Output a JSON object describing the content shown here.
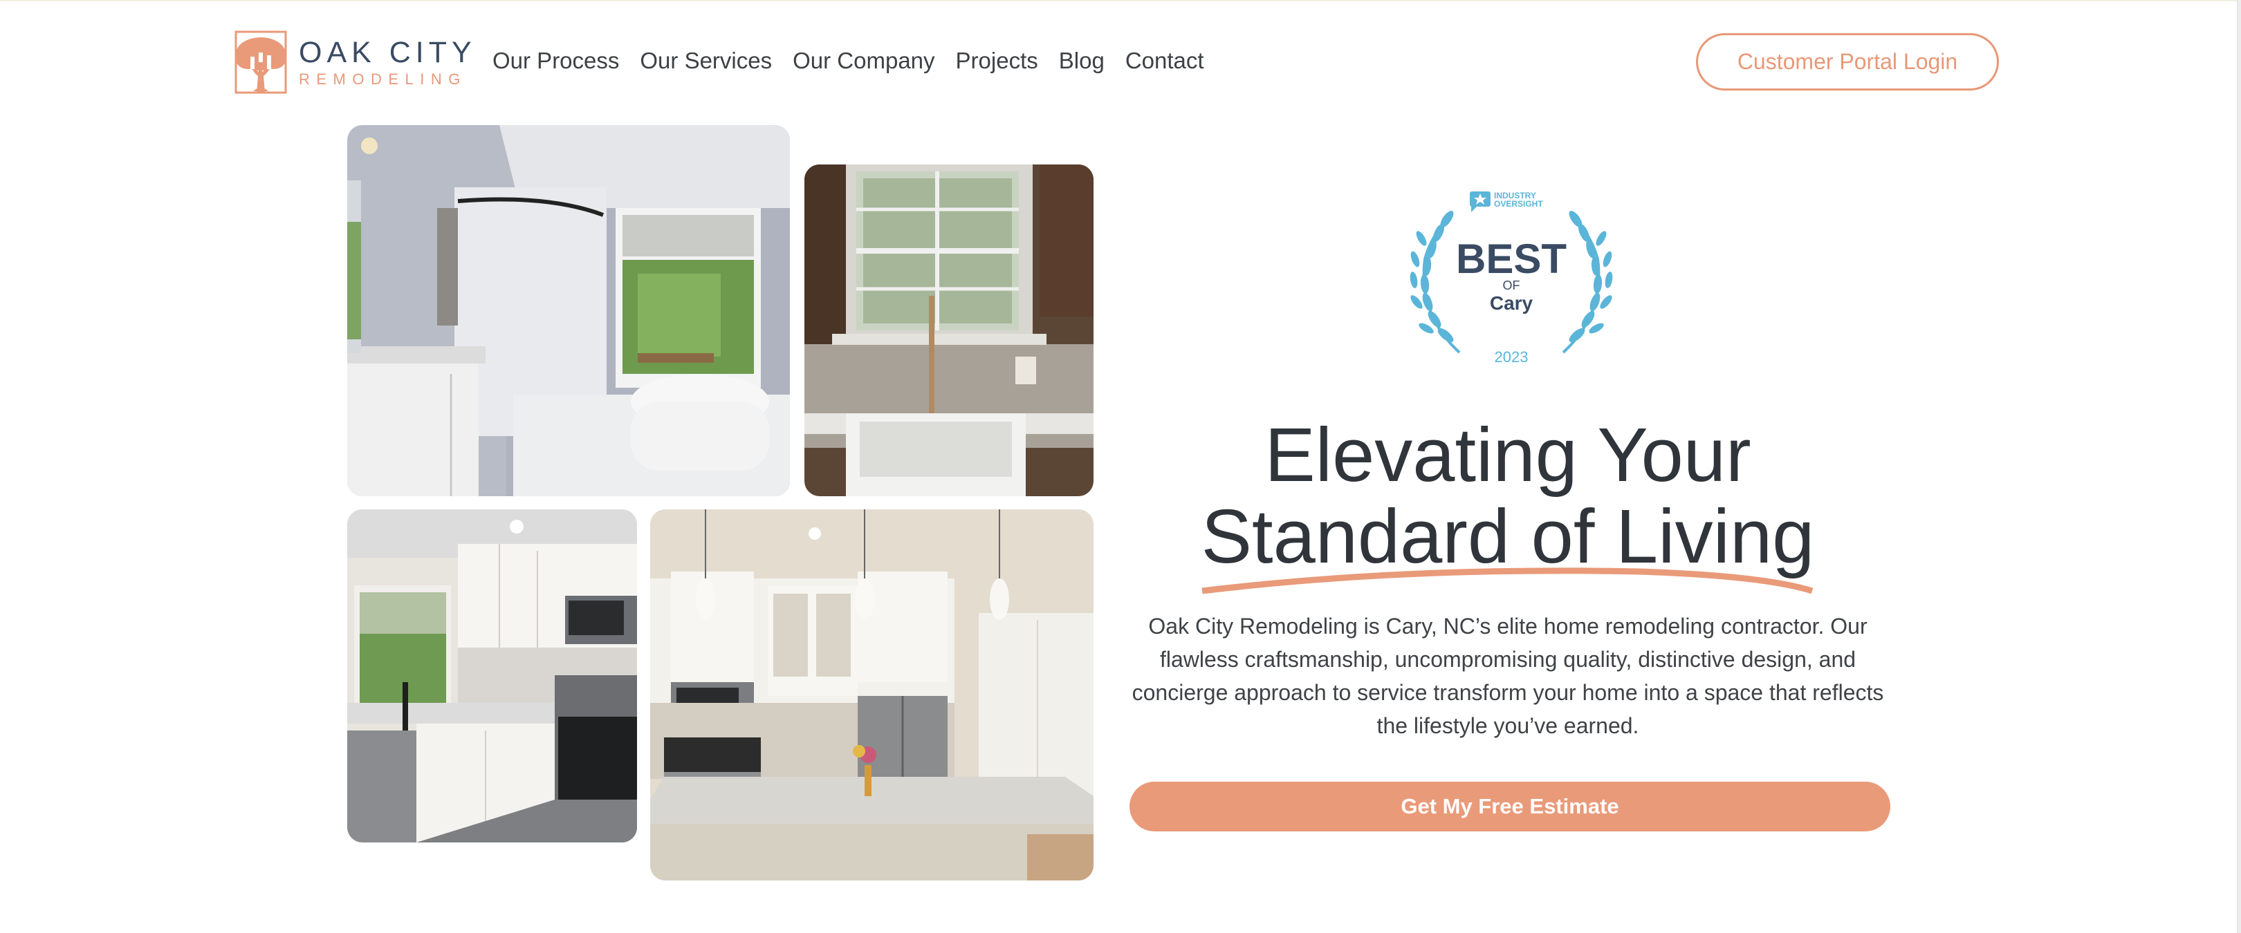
{
  "brand": {
    "name": "OAK CITY",
    "tagline": "REMODELING",
    "colors": {
      "navy": "#3a4b63",
      "accent": "#e99a79",
      "badge_blue": "#5bb5d8",
      "text": "#30353b"
    }
  },
  "nav": {
    "items": [
      {
        "label": "Our Process"
      },
      {
        "label": "Our Services"
      },
      {
        "label": "Our Company"
      },
      {
        "label": "Projects"
      },
      {
        "label": "Blog"
      },
      {
        "label": "Contact"
      }
    ],
    "portal_login_label": "Customer Portal Login"
  },
  "gallery": {
    "photos": [
      {
        "subject": "bathroom with freestanding tub and walk-in shower"
      },
      {
        "subject": "farmhouse sink under window"
      },
      {
        "subject": "white kitchen with stainless appliances"
      },
      {
        "subject": "kitchen island with pendant lights"
      }
    ]
  },
  "badge": {
    "publisher_line1": "INDUSTRY",
    "publisher_line2": "OVERSIGHT",
    "title": "BEST",
    "of": "OF",
    "city": "Cary",
    "year": "2023"
  },
  "hero": {
    "title_line1": "Elevating Your",
    "title_line2": "Standard of Living",
    "description": "Oak City Remodeling is Cary, NC’s elite home remodeling contractor. Our flawless craftsmanship, uncompromising quality, distinctive design, and concierge approach to service transform your home into a space that reflects the lifestyle you’ve earned.",
    "cta_label": "Get My Free Estimate"
  }
}
